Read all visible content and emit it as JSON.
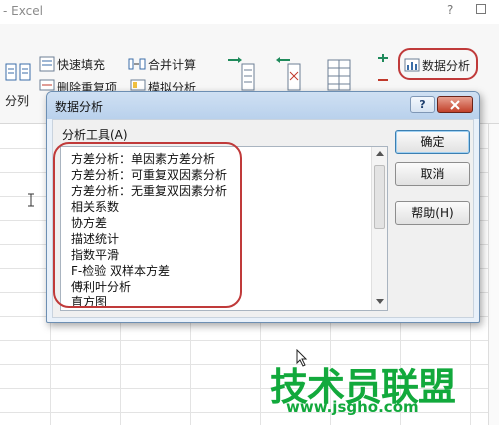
{
  "window": {
    "title": "- Excel",
    "help_glyph": "?"
  },
  "ribbon": {
    "text_to_columns_label": "分列",
    "flash_fill_label": "快速填充",
    "remove_duplicates_label": "删除重复项",
    "consolidate_label": "合并计算",
    "what_if_label": "模拟分析",
    "data_analysis_label": "数据分析"
  },
  "dialog": {
    "title": "数据分析",
    "help_glyph": "?",
    "tools_label": "分析工具(A)",
    "tools": [
      "方差分析：单因素方差分析",
      "方差分析：可重复双因素分析",
      "方差分析：无重复双因素分析",
      "相关系数",
      "协方差",
      "描述统计",
      "指数平滑",
      "F-检验 双样本方差",
      "傅利叶分析",
      "直方图"
    ],
    "ok_label": "确定",
    "cancel_label": "取消",
    "help_label": "帮助(H)"
  },
  "watermark": {
    "logo_text": "技术员联盟",
    "url": "www.jsgho.com"
  },
  "colors": {
    "annotation_ring": "#c03a3a",
    "watermark_green": "#12a93c",
    "dialog_frame": "#6d8fb3"
  }
}
